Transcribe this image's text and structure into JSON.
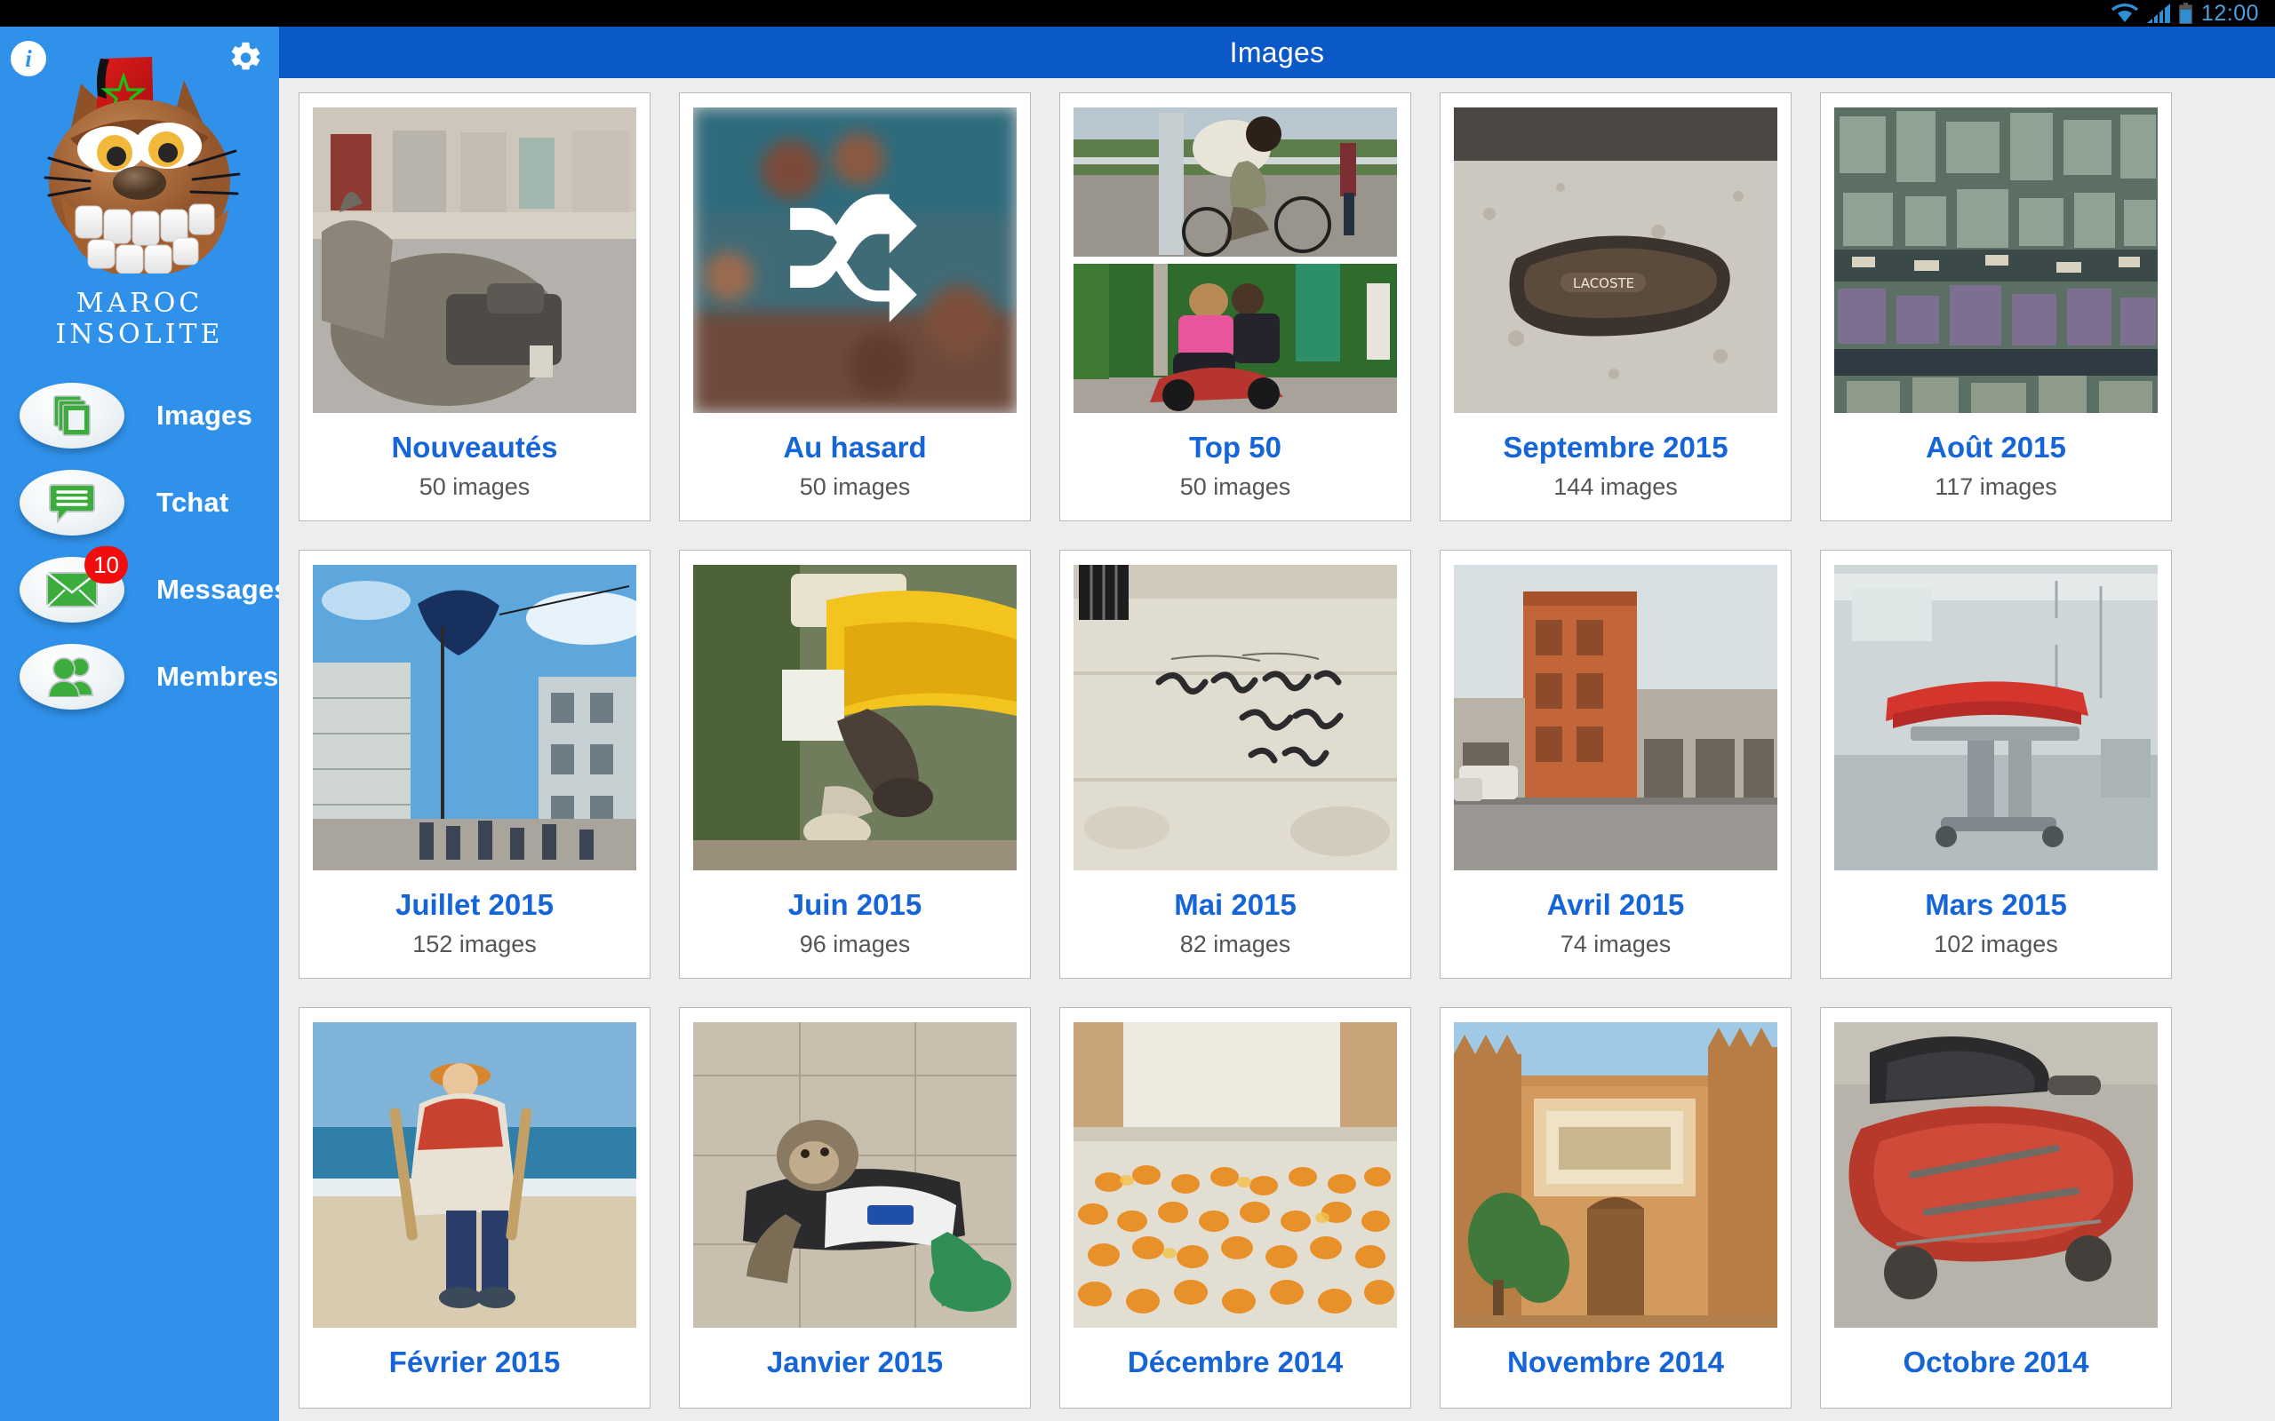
{
  "statusbar": {
    "clock": "12:00",
    "icons": [
      "wifi-icon",
      "signal-icon",
      "battery-icon"
    ]
  },
  "appbar": {
    "title": "Images"
  },
  "sidebar": {
    "brand": "MAROC INSOLITE",
    "info_label": "i",
    "info_icon": "info-icon",
    "settings_icon": "gear-icon",
    "mascot_icon": "cat-mascot-logo",
    "items": [
      {
        "label": "Images",
        "icon": "images-stack-icon",
        "badge": null
      },
      {
        "label": "Tchat",
        "icon": "chat-bubble-icon",
        "badge": null
      },
      {
        "label": "Messages",
        "icon": "envelope-icon",
        "badge": "10"
      },
      {
        "label": "Membres",
        "icon": "people-icon",
        "badge": null
      }
    ]
  },
  "colors": {
    "sidebar_blue": "#3091ea",
    "appbar_blue": "#0b58c9",
    "card_title_blue": "#1565d8",
    "badge_red": "#f20d0d",
    "icon_green": "#3cad3c",
    "content_bg": "#ededed"
  },
  "gallery": {
    "rows": [
      [
        {
          "title": "Nouveautés",
          "count": "50 images",
          "thumb": "donkey-street-scene"
        },
        {
          "title": "Au hasard",
          "count": "50 images",
          "thumb": "shuffle-icon-blurred-beach"
        },
        {
          "title": "Top 50",
          "count": "50 images",
          "thumb": "split-bicycle-goat-and-scooter"
        },
        {
          "title": "Septembre 2015",
          "count": "144 images",
          "thumb": "sandal-on-concrete"
        },
        {
          "title": "Août 2015",
          "count": "117 images",
          "thumb": "aerial-city-traffic"
        }
      ],
      [
        {
          "title": "Juillet 2015",
          "count": "152 images",
          "thumb": "flag-on-building"
        },
        {
          "title": "Juin 2015",
          "count": "96 images",
          "thumb": "legs-under-yellow-curtain"
        },
        {
          "title": "Mai 2015",
          "count": "82 images",
          "thumb": "arabic-graffiti-wall"
        },
        {
          "title": "Avril 2015",
          "count": "74 images",
          "thumb": "orange-building-street"
        },
        {
          "title": "Mars 2015",
          "count": "102 images",
          "thumb": "hospital-operating-table"
        }
      ],
      [
        {
          "title": "Février 2015",
          "count": "",
          "thumb": "costumed-person-on-beach"
        },
        {
          "title": "Janvier 2015",
          "count": "",
          "thumb": "monkey-in-football-shirt"
        },
        {
          "title": "Décembre 2014",
          "count": "",
          "thumb": "pastries-laid-on-floor"
        },
        {
          "title": "Novembre 2014",
          "count": "",
          "thumb": "kasbah-earthen-building"
        },
        {
          "title": "Octobre 2014",
          "count": "",
          "thumb": "red-moped-closeup"
        }
      ]
    ]
  }
}
